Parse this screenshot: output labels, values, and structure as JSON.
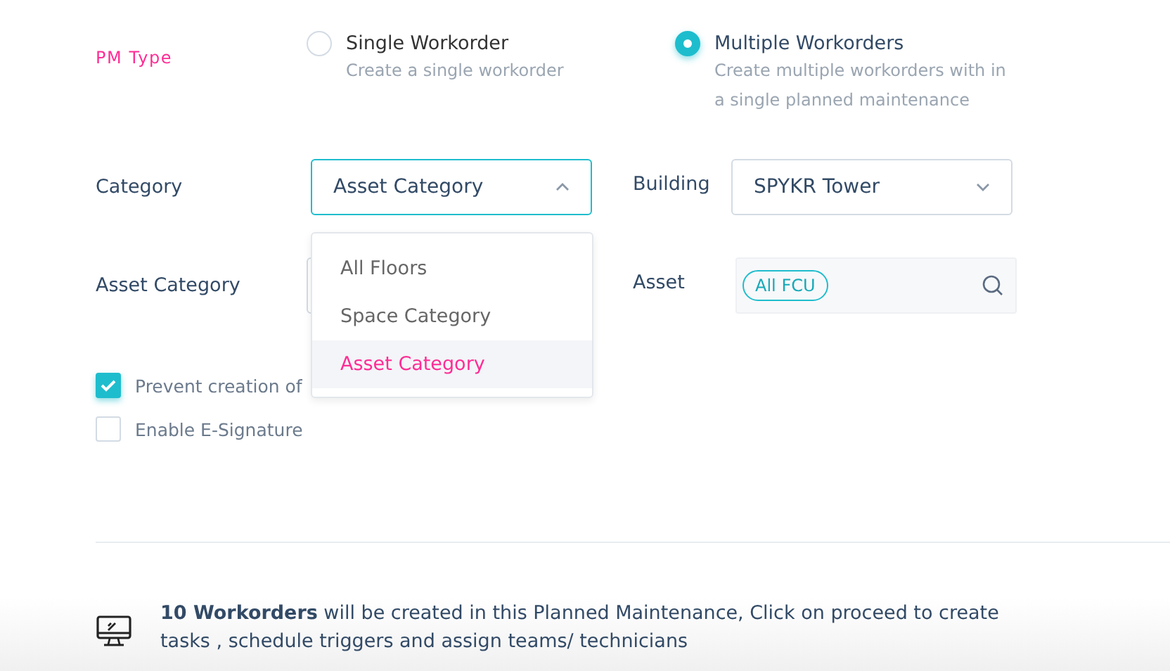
{
  "pm_type": {
    "label": "PM Type",
    "options": [
      {
        "title": "Single Workorder",
        "description": "Create a single workorder",
        "selected": false
      },
      {
        "title": "Multiple Workorders",
        "description": "Create multiple workorders with in a single planned maintenance",
        "selected": true
      }
    ]
  },
  "category": {
    "label": "Category",
    "value": "Asset Category",
    "expanded": true,
    "options": [
      {
        "label": "All Floors",
        "selected": false
      },
      {
        "label": "Space Category",
        "selected": false
      },
      {
        "label": "Asset Category",
        "selected": true
      }
    ]
  },
  "building": {
    "label": "Building",
    "value": "SPYKR Tower"
  },
  "asset_category": {
    "label": "Asset Category"
  },
  "asset": {
    "label": "Asset",
    "tags": [
      "All FCU"
    ]
  },
  "checkboxes": [
    {
      "label": "Prevent creation of",
      "checked": true
    },
    {
      "label": "Enable E-Signature",
      "checked": false
    }
  ],
  "summary": {
    "text": "**10 Workorders** will be created in this Planned Maintenance, Click on proceed to create tasks , schedule triggers and assign teams/ technicians"
  }
}
